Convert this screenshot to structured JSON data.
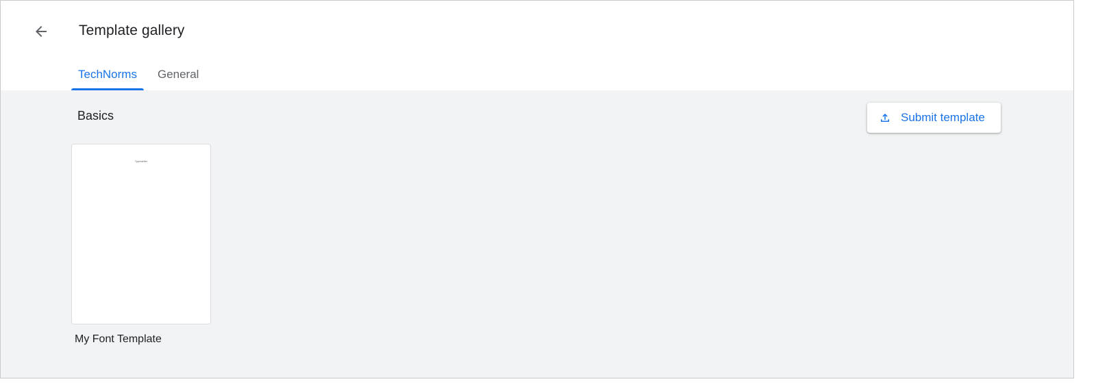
{
  "header": {
    "title": "Template gallery",
    "back_icon": "arrow-left-icon"
  },
  "tabs": [
    {
      "label": "TechNorms",
      "active": true
    },
    {
      "label": "General",
      "active": false
    }
  ],
  "section": {
    "title": "Basics"
  },
  "submit_button": {
    "label": "Submit template",
    "icon": "upload-icon"
  },
  "templates": [
    {
      "name": "My Font Template",
      "thumbnail_text": "Typewriter"
    }
  ],
  "colors": {
    "accent": "#1a73e8",
    "gallery_background": "#f1f3f4",
    "text_primary": "#202124",
    "text_secondary": "#5f6368"
  }
}
